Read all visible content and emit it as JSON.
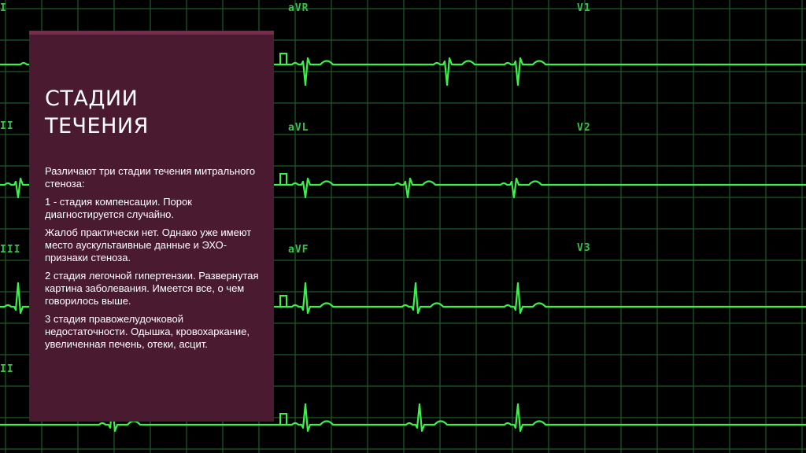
{
  "slide": {
    "title_line1": "СТАДИИ",
    "title_line2": "ТЕЧЕНИЯ",
    "paragraphs": [
      "Различают три стадии течения митрального стеноза:",
      "1 - стадия компенсации. Порок диагностируется случайно.",
      "Жалоб практически нет. Однако уже имеют место аускультаивные данные и ЭХО- признаки стеноза.",
      "2 стадия легочной гипертензии. Развернутая картина заболевания. Имеется все, о чем говорилось выше.",
      "3 стадия правожелудочковой недостаточности. Одышка, кровохаркание, увеличенная печень, отеки, асцит."
    ]
  },
  "ecg_labels": {
    "col1": [
      "I",
      "II",
      "III",
      "II"
    ],
    "col2": [
      "aVR",
      "aVL",
      "aVF"
    ],
    "col3": [
      "V1",
      "V2",
      "V3"
    ]
  },
  "colors": {
    "grid": "#1f5a2a",
    "trace": "#3cf04a",
    "panel": "#4a1a31",
    "background": "#000000"
  }
}
